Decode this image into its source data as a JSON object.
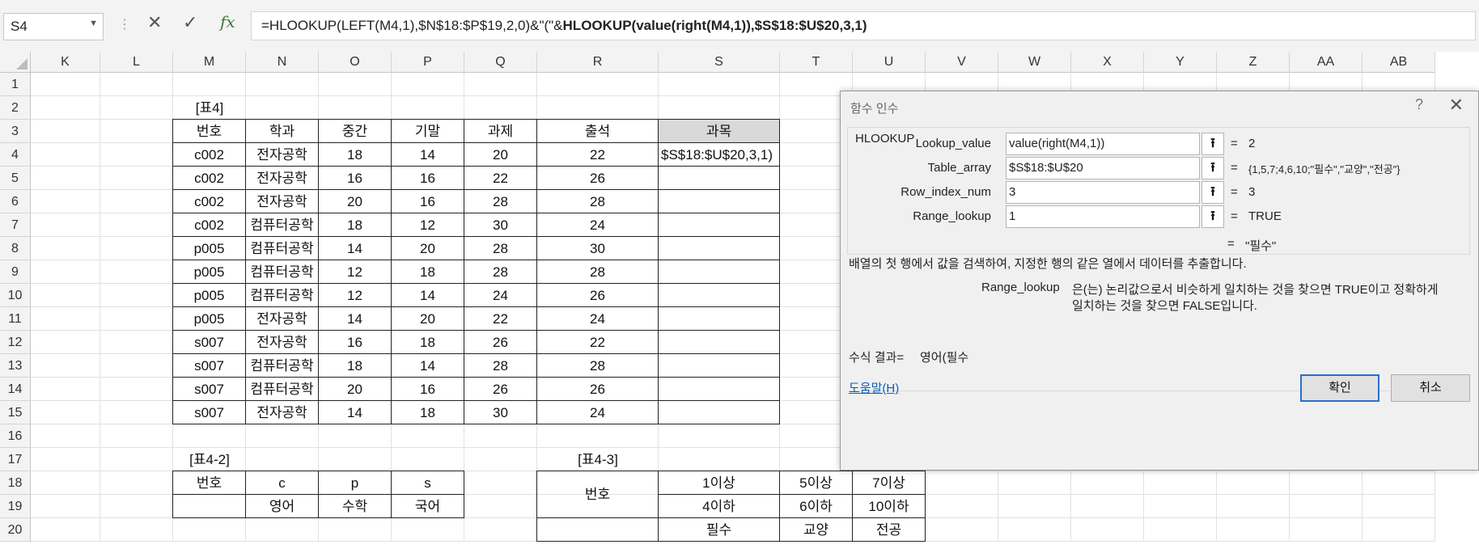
{
  "name_box": "S4",
  "formula_icons": {
    "cancel": "✕",
    "enter": "✓",
    "fx": "fx"
  },
  "formula": {
    "part1": "=HLOOKUP(LEFT(M4,1),$N$18:$P$19,2,0)&\"(\"&",
    "part2": "HLOOKUP(value(right(M4,1)),$S$18:$U$20,3,1)"
  },
  "columns": [
    "K",
    "L",
    "M",
    "N",
    "O",
    "P",
    "Q",
    "R",
    "S",
    "T",
    "U",
    "V",
    "W",
    "X",
    "Y",
    "Z",
    "AA",
    "AB"
  ],
  "rows": [
    "1",
    "2",
    "3",
    "4",
    "5",
    "6",
    "7",
    "8",
    "9",
    "10",
    "11",
    "12",
    "13",
    "14",
    "15",
    "16",
    "17",
    "18",
    "19",
    "20"
  ],
  "table4": {
    "label": "[표4]",
    "headers": [
      "번호",
      "학과",
      "중간",
      "기말",
      "과제",
      "출석",
      "과목"
    ],
    "rows": [
      [
        "c002",
        "전자공학",
        "18",
        "14",
        "20",
        "22",
        "$S$18:$U$20,3,1)"
      ],
      [
        "c002",
        "전자공학",
        "16",
        "16",
        "22",
        "26",
        ""
      ],
      [
        "c002",
        "전자공학",
        "20",
        "16",
        "28",
        "28",
        ""
      ],
      [
        "c002",
        "컴퓨터공학",
        "18",
        "12",
        "30",
        "24",
        ""
      ],
      [
        "p005",
        "컴퓨터공학",
        "14",
        "20",
        "28",
        "30",
        ""
      ],
      [
        "p005",
        "컴퓨터공학",
        "12",
        "18",
        "28",
        "28",
        ""
      ],
      [
        "p005",
        "컴퓨터공학",
        "12",
        "14",
        "24",
        "26",
        ""
      ],
      [
        "p005",
        "전자공학",
        "14",
        "20",
        "22",
        "24",
        ""
      ],
      [
        "s007",
        "전자공학",
        "16",
        "18",
        "26",
        "22",
        ""
      ],
      [
        "s007",
        "컴퓨터공학",
        "18",
        "14",
        "28",
        "28",
        ""
      ],
      [
        "s007",
        "컴퓨터공학",
        "20",
        "16",
        "26",
        "26",
        ""
      ],
      [
        "s007",
        "전자공학",
        "14",
        "18",
        "30",
        "24",
        ""
      ]
    ]
  },
  "table42": {
    "label": "[표4-2]",
    "r1": [
      "번호",
      "c",
      "p",
      "s"
    ],
    "r2": [
      "",
      "영어",
      "수학",
      "국어"
    ]
  },
  "table43": {
    "label": "[표4-3]",
    "head": "번호",
    "r1": [
      "1이상",
      "5이상",
      "7이상"
    ],
    "r2": [
      "4이하",
      "6이하",
      "10이하"
    ],
    "r3": [
      "필수",
      "교양",
      "전공"
    ]
  },
  "dialog": {
    "title": "함수 인수",
    "help_q": "?",
    "close": "✕",
    "function_name": "HLOOKUP",
    "args": [
      {
        "label": "Lookup_value",
        "value": "value(right(M4,1))",
        "result": "2"
      },
      {
        "label": "Table_array",
        "value": "$S$18:$U$20",
        "result": "{1,5,7;4,6,10;\"필수\",\"교양\",\"전공\"}"
      },
      {
        "label": "Row_index_num",
        "value": "3",
        "result": "3"
      },
      {
        "label": "Range_lookup",
        "value": "1",
        "result": "TRUE"
      }
    ],
    "eq": "=",
    "overall_result": "\"필수\"",
    "description": "배열의 첫 행에서 값을 검색하여, 지정한 행의 같은 열에서 데이터를 추출합니다.",
    "arg_desc_name": "Range_lookup",
    "arg_desc_line1": "은(는) 논리값으로서 비슷하게 일치하는 것을 찾으면 TRUE이고 정확하게",
    "arg_desc_line2": "일치하는 것을 찾으면 FALSE입니다.",
    "formula_result_label": "수식 결과=",
    "formula_result_value": "영어(필수",
    "help_link": "도움말(H)",
    "ok": "확인",
    "cancel": "취소"
  }
}
